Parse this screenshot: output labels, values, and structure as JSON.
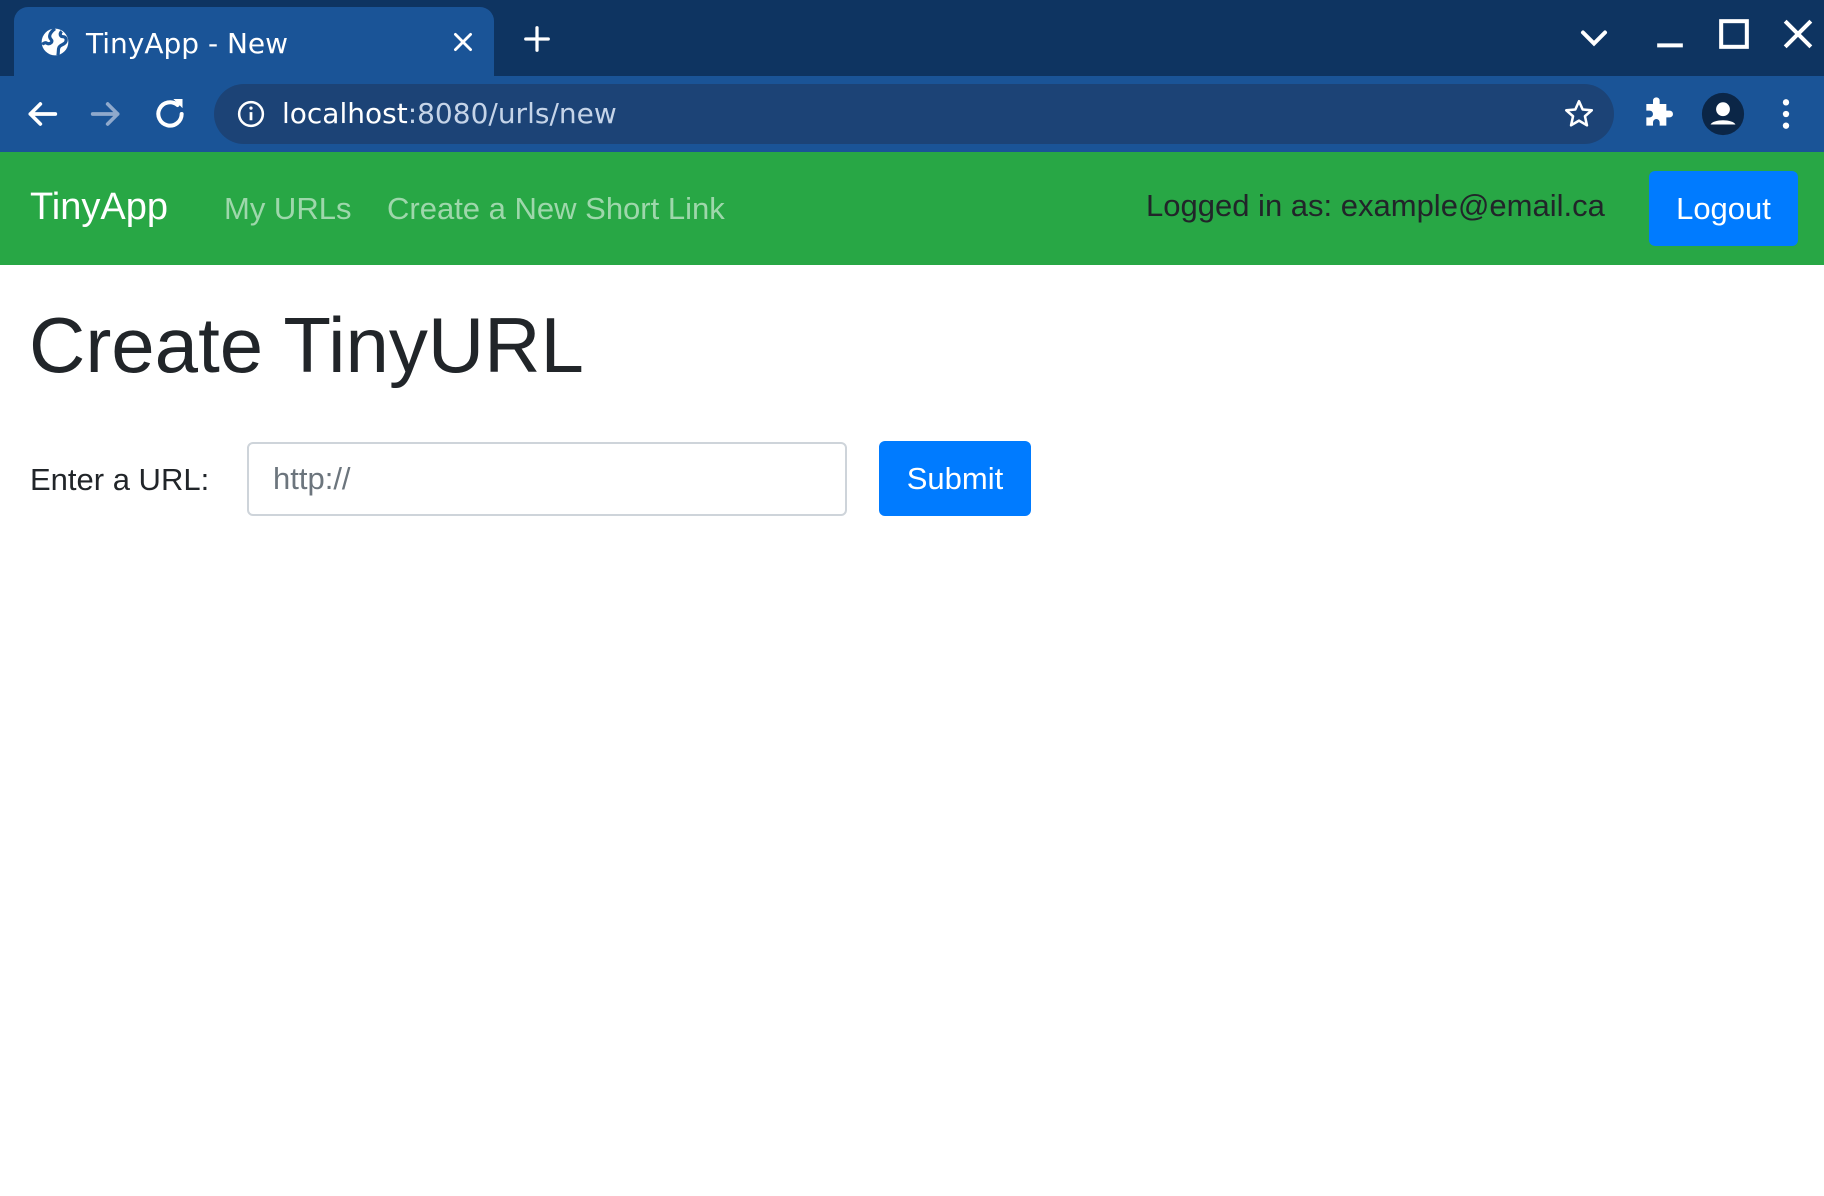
{
  "browser": {
    "tab": {
      "title": "TinyApp - New",
      "favicon_icon": "globe-icon"
    },
    "address_bar": {
      "host": "localhost",
      "path": ":8080/urls/new"
    },
    "colors": {
      "tabstrip": "#0e3461",
      "active_tab": "#1a5497",
      "omnibox": "#1c4376"
    }
  },
  "navbar": {
    "brand": "TinyApp",
    "links": [
      {
        "label": "My URLs"
      },
      {
        "label": "Create a New Short Link"
      }
    ],
    "logged_in_text": "Logged in as: example@email.ca",
    "logout_label": "Logout",
    "color": "#28a745"
  },
  "main": {
    "title": "Create TinyURL",
    "form": {
      "label": "Enter a URL:",
      "input_value": "",
      "input_placeholder": "http://",
      "submit_label": "Submit"
    },
    "accent": "#007bff"
  }
}
